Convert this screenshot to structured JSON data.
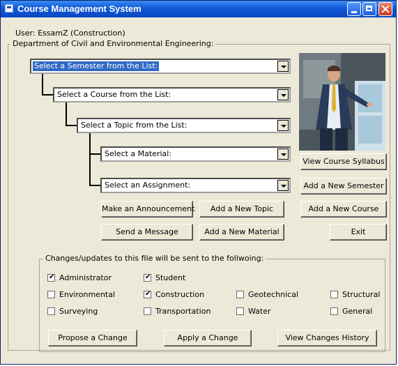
{
  "window": {
    "title": "Course Management System"
  },
  "user_label": "User: EssamZ (Construction)",
  "department": {
    "title": "Department of Civil and Environmental Engineering:"
  },
  "combos": {
    "semester": "Select a Semester from the List:",
    "course": "Select a Course from the List:",
    "topic": "Select a Topic from the List:",
    "material": "Select a Material:",
    "assignment": "Select an Assignment:"
  },
  "buttons": {
    "view_syllabus": "View Course Syllabus",
    "add_semester": "Add a New Semester",
    "add_course": "Add a New Course",
    "exit": "Exit",
    "announcement": "Make an Announcement",
    "add_topic": "Add a New Topic",
    "send_message": "Send a Message",
    "add_material": "Add a New Material"
  },
  "changes": {
    "title": "Changes/updates to this file will be sent to the follwoing:",
    "checkboxes": [
      {
        "label": "Administrator",
        "checked": true
      },
      {
        "label": "Student",
        "checked": true
      },
      {
        "label": "Environmental",
        "checked": false
      },
      {
        "label": "Construction",
        "checked": true
      },
      {
        "label": "Geotechnical",
        "checked": false
      },
      {
        "label": "Structural",
        "checked": false
      },
      {
        "label": "Surveying",
        "checked": false
      },
      {
        "label": "Transportation",
        "checked": false
      },
      {
        "label": "Water",
        "checked": false
      },
      {
        "label": "General",
        "checked": false
      }
    ],
    "buttons": {
      "propose": "Propose a Change",
      "apply": "Apply a Change",
      "history": "View Changes History"
    }
  },
  "check_glyph": "✔"
}
